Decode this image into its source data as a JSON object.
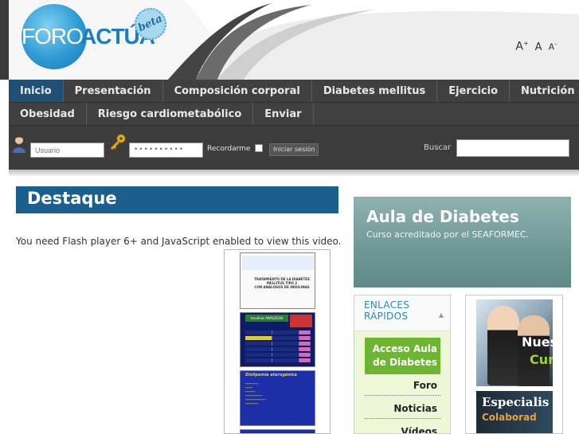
{
  "header": {
    "logo": {
      "foro": "FORO",
      "actua": "ACTÚA",
      "beta": "beta"
    },
    "font_sizer": {
      "increase": "A",
      "increase_mark": "+",
      "normal": "A",
      "decrease": "A",
      "decrease_mark": "-"
    }
  },
  "nav": {
    "items_row1": [
      "Inicio",
      "Presentación",
      "Composición corporal",
      "Diabetes mellitus",
      "Ejercicio",
      "Nutrición"
    ],
    "items_row2": [
      "Obesidad",
      "Riesgo cardiometabólico",
      "Enviar"
    ],
    "active": "Inicio"
  },
  "login": {
    "username_placeholder": "Usuario",
    "password_value": "••••••••••",
    "remember_label": "Recordarme",
    "submit_label": "Iniciar sesión",
    "search_label": "Buscar",
    "search_value": ""
  },
  "main": {
    "section_title": "Destaque",
    "flash_message": "You need Flash player 6+ and JavaScript enabled to view this video.",
    "thumbnails": [
      {
        "lines": [
          "TRATAMIENTO DE LA DIABETES",
          "MELLITUS TIPO 2",
          "CON ANALOGOS DE INSULINAS"
        ]
      },
      {
        "heading": "Insulinas ANALOGAS"
      },
      {
        "heading": "Dislipemia aterogénica"
      },
      {
        "heading": ""
      }
    ]
  },
  "sidebar": {
    "banner_title": "Aula de Diabetes",
    "banner_subtitle": "Curso acreditado por el SEAFORMEC.",
    "quick_links_title": "ENLACES RÁPIDOS",
    "featured_link": "Acceso Aula de Diabetes",
    "links": [
      "Foro",
      "Noticias",
      "Vídeos"
    ],
    "promo1_line1": "Nues",
    "promo1_line2": "Cur",
    "promo2_line1": "Especialis",
    "promo2_line2": "Colaborad"
  },
  "colors": {
    "nav_bg": "#404040",
    "nav_active": "#1f4f75",
    "destaque_bar": "#1b5f8d",
    "featured_link_bg": "#6eb534",
    "banner_bg": "#7aa3a1"
  }
}
